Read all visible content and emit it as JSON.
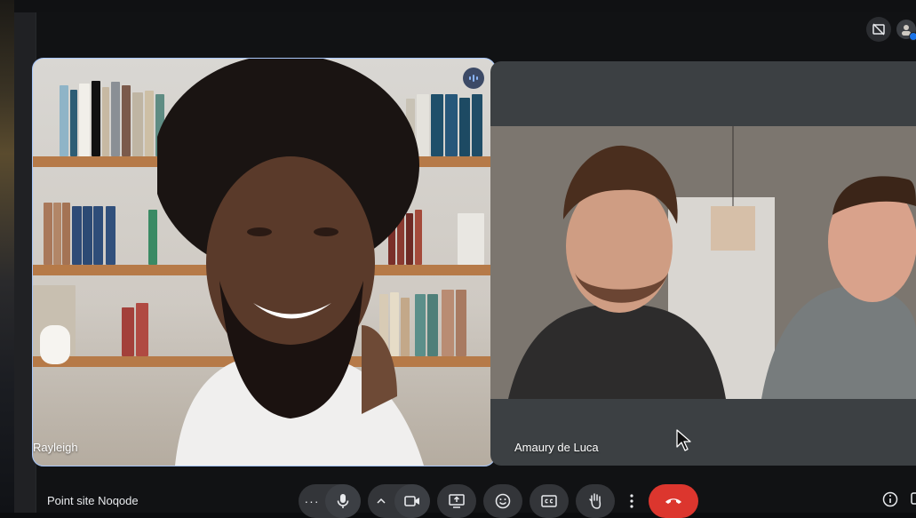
{
  "meeting": {
    "title": "Point site Noqode"
  },
  "participants": [
    {
      "name": "Rayleigh",
      "speaking": true
    },
    {
      "name": "Amaury de Luca",
      "speaking": false
    }
  ],
  "controls": {
    "more_label": "···",
    "mic": "microphone-icon",
    "options": "chevron-up-icon",
    "camera": "camera-icon",
    "present": "present-screen-icon",
    "reactions": "emoji-icon",
    "captions": "captions-icon",
    "raise_hand": "raise-hand-icon",
    "more_options": "more-vert-icon",
    "leave": "end-call-icon"
  },
  "colors": {
    "accent_border": "#a8c7fa",
    "end_call": "#dc362e",
    "control_bg": "#333539",
    "speaking_indicator": "#8ab4f8"
  }
}
